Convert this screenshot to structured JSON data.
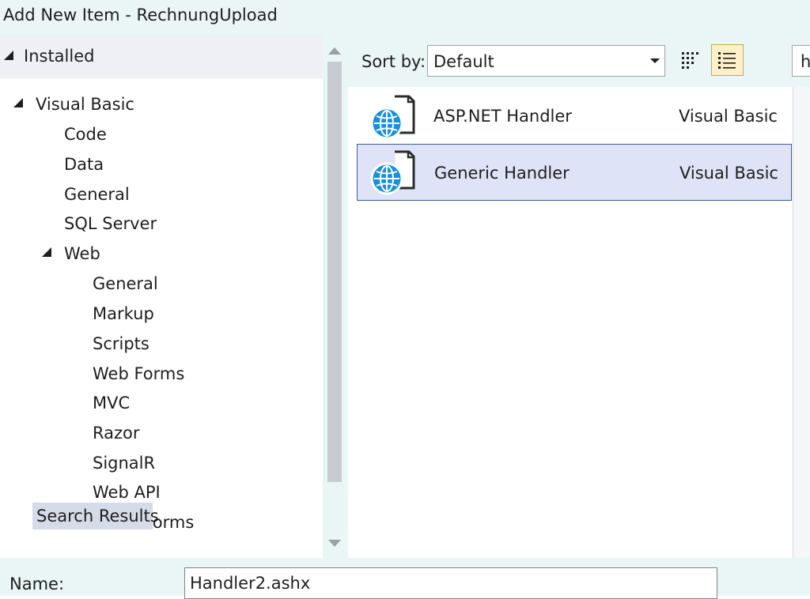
{
  "window": {
    "title": "Add New Item - RechnungUpload"
  },
  "tree": {
    "header": "Installed",
    "nodes": {
      "visual_basic": "Visual Basic",
      "code": "Code",
      "data": "Data",
      "general": "General",
      "sql_server": "SQL Server",
      "web": "Web",
      "web_general": "General",
      "markup": "Markup",
      "scripts": "Scripts",
      "web_forms": "Web Forms",
      "mvc": "MVC",
      "razor": "Razor",
      "signalr": "SignalR",
      "web_api": "Web API",
      "windows_forms": "Windows Forms",
      "search_results": "Search Results"
    }
  },
  "toolbar": {
    "sort_label": "Sort by:",
    "sort_value": "Default",
    "search_value": "h"
  },
  "items": [
    {
      "name": "ASP.NET Handler",
      "language": "Visual Basic",
      "icon": "web-handler-icon",
      "selected": false
    },
    {
      "name": "Generic Handler",
      "language": "Visual Basic",
      "icon": "web-handler-icon",
      "selected": true
    }
  ],
  "footer": {
    "name_label": "Name:",
    "name_value": "Handler2.ashx"
  },
  "colors": {
    "title_bg": "#eaf6f5",
    "selection_bg": "#dfe3f7",
    "selection_border": "#3e5b9c",
    "globe": "#1a8fd9",
    "active_view_bg": "#fff0c8"
  }
}
